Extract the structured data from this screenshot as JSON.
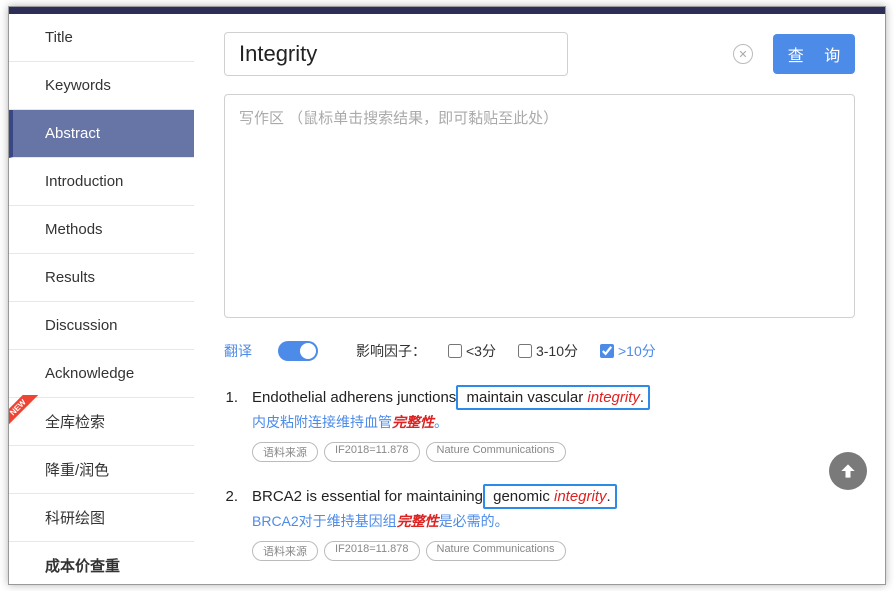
{
  "sidebar": {
    "items": [
      {
        "label": "Title",
        "active": false
      },
      {
        "label": "Keywords",
        "active": false
      },
      {
        "label": "Abstract",
        "active": true
      },
      {
        "label": "Introduction",
        "active": false
      },
      {
        "label": "Methods",
        "active": false
      },
      {
        "label": "Results",
        "active": false
      },
      {
        "label": "Discussion",
        "active": false
      },
      {
        "label": "Acknowledge",
        "active": false
      },
      {
        "label": "全库检索",
        "active": false,
        "new": true
      },
      {
        "label": "降重/润色",
        "active": false
      },
      {
        "label": "科研绘图",
        "active": false
      },
      {
        "label": "成本价查重",
        "active": false,
        "bold": true
      }
    ],
    "new_badge": "NEW"
  },
  "search": {
    "value": "Integrity",
    "query_button": "查 询"
  },
  "writing_area": {
    "placeholder": "写作区 （鼠标单击搜索结果，即可黏贴至此处）"
  },
  "filters": {
    "translate_label": "翻译",
    "factor_label": "影响因子：",
    "options": {
      "lt3": "<3分",
      "mid": "3-10分",
      "gt10": ">10分"
    },
    "checked": "gt10"
  },
  "results": [
    {
      "num": "1.",
      "en_before": "Endothelial adherens junctions",
      "en_boxed": " maintain vascular integrity.",
      "cn_before": "内皮粘附连接维持血管",
      "cn_hl": "完整性",
      "cn_after": "。",
      "tags": [
        "语料来源",
        "IF2018=11.878",
        "Nature Communications"
      ]
    },
    {
      "num": "2.",
      "en_before": "BRCA2 is essential for maintaining",
      "en_boxed": " genomic integrity.",
      "cn_before": "BRCA2对于维持基因组",
      "cn_hl": "完整性",
      "cn_after": "是必需的。",
      "tags": [
        "语料来源",
        "IF2018=11.878",
        "Nature Communications"
      ]
    }
  ]
}
